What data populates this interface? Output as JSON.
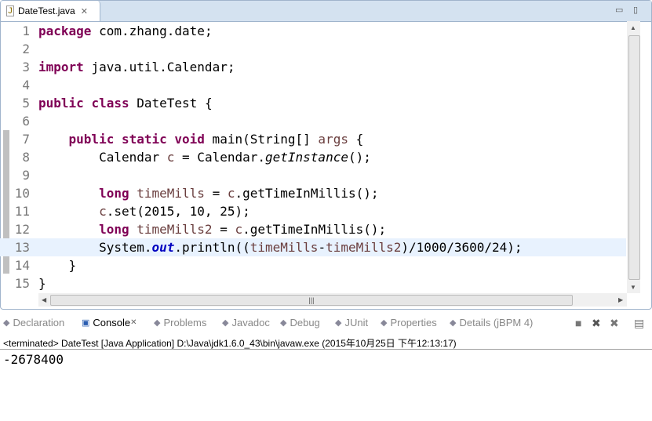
{
  "editor": {
    "tab_label": "DateTest.java",
    "lines": [
      {
        "n": "1",
        "parts": [
          [
            "k",
            "package"
          ],
          [
            "",
            "com.zhang.date;"
          ]
        ]
      },
      {
        "n": "2",
        "parts": []
      },
      {
        "n": "3",
        "parts": [
          [
            "k",
            "import"
          ],
          [
            "",
            "java.util.Calendar;"
          ]
        ]
      },
      {
        "n": "4",
        "parts": []
      },
      {
        "n": "5",
        "parts": [
          [
            "k",
            "public"
          ],
          [
            "k",
            "class"
          ],
          [
            "",
            "DateTest {"
          ]
        ]
      },
      {
        "n": "6",
        "parts": []
      },
      {
        "n": "7",
        "raw": [
          [
            "",
            "    "
          ],
          [
            "k",
            "public static void"
          ],
          [
            "",
            " main(String[] "
          ],
          [
            "v",
            "args"
          ],
          [
            "",
            " {"
          ]
        ]
      },
      {
        "n": "8",
        "raw": [
          [
            "",
            "        Calendar "
          ],
          [
            "v",
            "c"
          ],
          [
            "",
            " = Calendar."
          ],
          [
            "i",
            "getInstance"
          ],
          [
            "",
            "();"
          ]
        ]
      },
      {
        "n": "9",
        "raw": []
      },
      {
        "n": "10",
        "raw": [
          [
            "",
            "        "
          ],
          [
            "k",
            "long"
          ],
          [
            "",
            " "
          ],
          [
            "v",
            "timeMills"
          ],
          [
            "",
            " = "
          ],
          [
            "v",
            "c"
          ],
          [
            "",
            ".getTimeInMillis();"
          ]
        ]
      },
      {
        "n": "11",
        "raw": [
          [
            "",
            "        "
          ],
          [
            "v",
            "c"
          ],
          [
            "",
            ".set(2015, 10, 25);"
          ]
        ]
      },
      {
        "n": "12",
        "raw": [
          [
            "",
            "        "
          ],
          [
            "k",
            "long"
          ],
          [
            "",
            " "
          ],
          [
            "v",
            "timeMills2"
          ],
          [
            "",
            " = "
          ],
          [
            "v",
            "c"
          ],
          [
            "",
            ".getTimeInMillis();"
          ]
        ]
      },
      {
        "n": "13",
        "raw": [
          [
            "",
            "        System."
          ],
          [
            "f",
            "out"
          ],
          [
            "",
            ".println(("
          ],
          [
            "v",
            "timeMills"
          ],
          [
            "",
            "-"
          ],
          [
            "v",
            "timeMills2"
          ],
          [
            "",
            ")/1000/3600/24);"
          ]
        ]
      },
      {
        "n": "14",
        "raw": [
          [
            "",
            "    }"
          ]
        ]
      },
      {
        "n": "15",
        "raw": [
          [
            "",
            "}"
          ]
        ]
      }
    ]
  },
  "console": {
    "tabs": [
      {
        "label": "Declaration",
        "icon": "declaration-icon"
      },
      {
        "label": "Console",
        "icon": "console-icon",
        "active": true
      },
      {
        "label": "Problems",
        "icon": "problems-icon"
      },
      {
        "label": "Javadoc",
        "icon": "javadoc-icon"
      },
      {
        "label": "Debug",
        "icon": "debug-icon"
      },
      {
        "label": "JUnit",
        "icon": "junit-icon"
      },
      {
        "label": "Properties",
        "icon": "properties-icon"
      },
      {
        "label": "Details (jBPM 4)",
        "icon": "details-icon"
      }
    ],
    "header": "<terminated> DateTest [Java Application] D:\\Java\\jdk1.6.0_43\\bin\\javaw.exe (2015年10月25日 下午12:13:17)",
    "output": "-2678400"
  }
}
